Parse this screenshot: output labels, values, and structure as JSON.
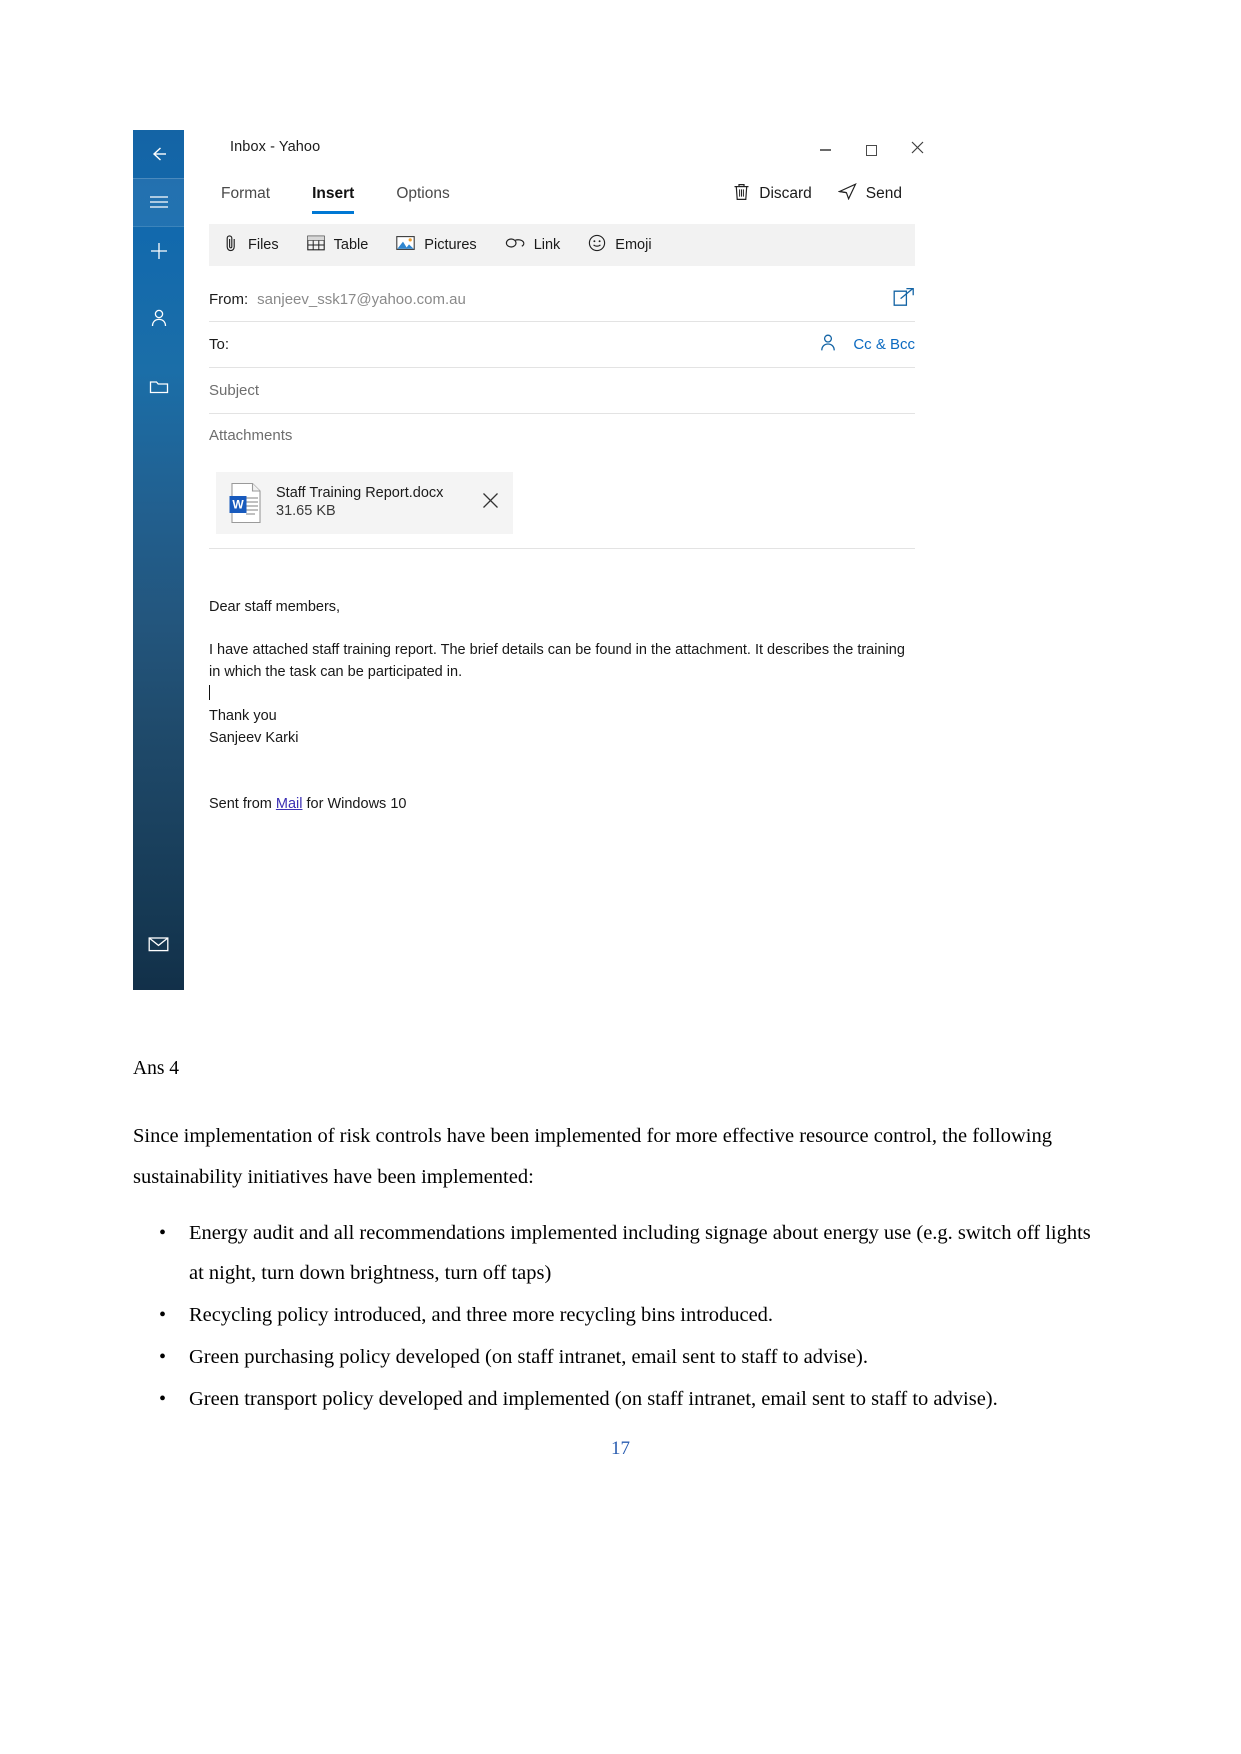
{
  "mail_app": {
    "window_title": "Inbox - Yahoo",
    "window_controls": {
      "minimize": "minimize-icon",
      "maximize": "maximize-icon",
      "close": "close-icon"
    },
    "nav_rail": {
      "back": "back-arrow-icon",
      "hamburger": "hamburger-menu-icon",
      "new_mail": "plus-new-mail-icon",
      "people": "people-icon",
      "folders": "folder-icon",
      "mail": "mail-envelope-icon",
      "calendar": "calendar-icon"
    },
    "tabs": [
      {
        "label": "Format",
        "active": false
      },
      {
        "label": "Insert",
        "active": true
      },
      {
        "label": "Options",
        "active": false
      }
    ],
    "actions": [
      {
        "label": "Discard",
        "icon": "trash-icon"
      },
      {
        "label": "Send",
        "icon": "send-paper-plane-icon"
      }
    ],
    "toolbar": [
      {
        "label": "Files",
        "icon": "paperclip-icon"
      },
      {
        "label": "Table",
        "icon": "table-grid-icon"
      },
      {
        "label": "Pictures",
        "icon": "picture-image-icon"
      },
      {
        "label": "Link",
        "icon": "link-chain-icon"
      },
      {
        "label": "Emoji",
        "icon": "smiley-face-icon"
      }
    ],
    "compose": {
      "from_label": "From:",
      "from_value": "sanjeev_ssk17@yahoo.com.au",
      "from_popout_icon": "pop-out-window-icon",
      "to_label": "To:",
      "to_value": "",
      "to_people_icon": "person-picker-icon",
      "cc_bcc_label": "Cc & Bcc",
      "subject_placeholder": "Subject",
      "subject_value": "",
      "attachments_label": "Attachments"
    },
    "attachment": {
      "file_icon": "word-document-icon",
      "file_name": "Staff Training Report.docx",
      "file_size": "31.65 KB",
      "remove_icon": "close-x-icon"
    },
    "message_body": {
      "greeting": "Dear staff members,",
      "paragraph": "I have attached staff training report. The brief details can be found in the attachment. It describes the training in which the task can be participated in.",
      "closing": "Thank you",
      "signature_name": "Sanjeev Karki",
      "sent_from_prefix": "Sent from ",
      "sent_from_link": "Mail",
      "sent_from_suffix": " for Windows 10"
    },
    "colors": {
      "accent_blue": "#0078d4",
      "link_blue": "#0b6ac1",
      "nav_rail_top": "#1464a5",
      "word_blue": "#185abd",
      "mail_link_purple": "#3b2fb4"
    }
  },
  "document": {
    "heading": "Ans 4",
    "intro": "Since implementation of risk controls have been implemented for more effective resource control, the following sustainability initiatives have been implemented:",
    "bullets": [
      "Energy audit and all recommendations implemented including signage about energy use (e.g. switch off lights at night, turn down brightness, turn off taps)",
      "Recycling policy introduced, and three more recycling bins introduced.",
      "Green purchasing policy developed (on staff intranet, email sent to staff to advise).",
      "Green transport policy developed and implemented (on staff intranet, email sent to staff to advise)."
    ],
    "page_number": "17"
  }
}
